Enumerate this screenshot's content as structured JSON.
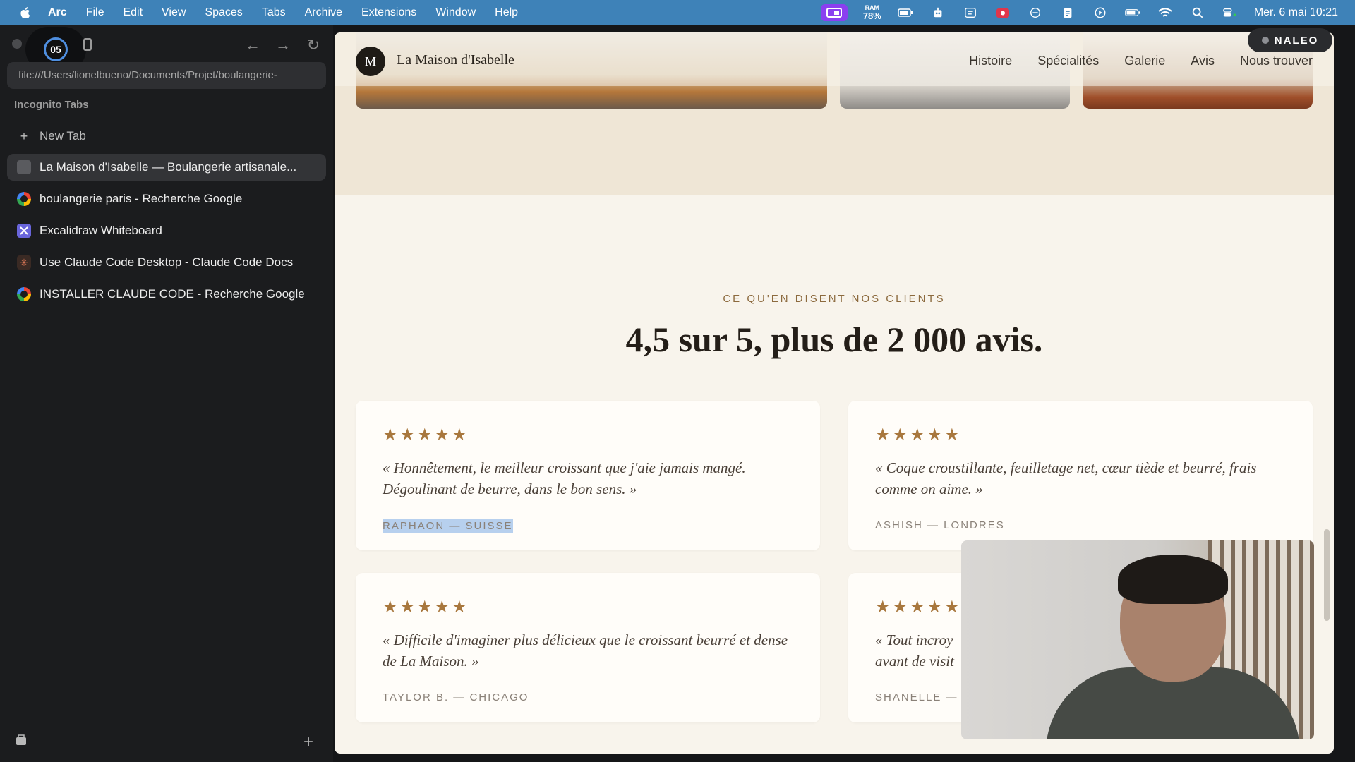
{
  "menubar": {
    "app_name": "Arc",
    "items": [
      "File",
      "Edit",
      "View",
      "Spaces",
      "Tabs",
      "Archive",
      "Extensions",
      "Window",
      "Help"
    ],
    "ram_label": "RAM",
    "ram_value": "78%",
    "clock": "Mer. 6 mai  10:21"
  },
  "recording": {
    "counter": "05"
  },
  "sidebar": {
    "url": "file:///Users/lionelbueno/Documents/Projet/boulangerie-",
    "section_label": "Incognito Tabs",
    "new_tab_label": "New Tab",
    "tabs": [
      {
        "label": "La Maison d'Isabelle — Boulangerie artisanale...",
        "icon": "page-icon",
        "active": true
      },
      {
        "label": "boulangerie paris - Recherche Google",
        "icon": "google-icon",
        "active": false
      },
      {
        "label": "Excalidraw Whiteboard",
        "icon": "excalidraw-icon",
        "active": false
      },
      {
        "label": "Use Claude Code Desktop - Claude Code Docs",
        "icon": "claude-icon",
        "active": false
      },
      {
        "label": "INSTALLER CLAUDE CODE - Recherche Google",
        "icon": "google-icon",
        "active": false
      }
    ]
  },
  "site": {
    "logo_letter": "M",
    "name": "La Maison d'Isabelle",
    "nav": [
      "Histoire",
      "Spécialités",
      "Galerie",
      "Avis",
      "Nous trouver"
    ],
    "eyebrow": "CE QU'EN DISENT NOS CLIENTS",
    "headline": "4,5 sur 5, plus de 2 000 avis.",
    "reviews": [
      {
        "stars": 5,
        "quote": "« Honnêtement, le meilleur croissant que j'aie jamais mangé. Dégoulinant de beurre, dans le bon sens. »",
        "author": "RAPHAON — SUISSE",
        "selected": true
      },
      {
        "stars": 5,
        "quote": "« Coque croustillante, feuilletage net, cœur tiède et beurré, frais comme on aime. »",
        "author": "ASHISH — LONDRES",
        "selected": false
      },
      {
        "stars": 5,
        "quote": "« Difficile d'imaginer plus délicieux que le croissant beurré et dense de La Maison. »",
        "author": "TAYLOR B. — CHICAGO",
        "selected": false
      },
      {
        "stars": 5,
        "quote": "« Tout incroy avant de visit",
        "author": "SHANELLE —",
        "selected": false
      }
    ]
  },
  "overlay": {
    "badge": "NALEO"
  },
  "colors": {
    "menubar": "#3e82b8",
    "sidebar": "#1b1c1e",
    "page_bg": "#f8f4ec",
    "accent_gold": "#a8773d",
    "selection": "#b7d0ee"
  }
}
